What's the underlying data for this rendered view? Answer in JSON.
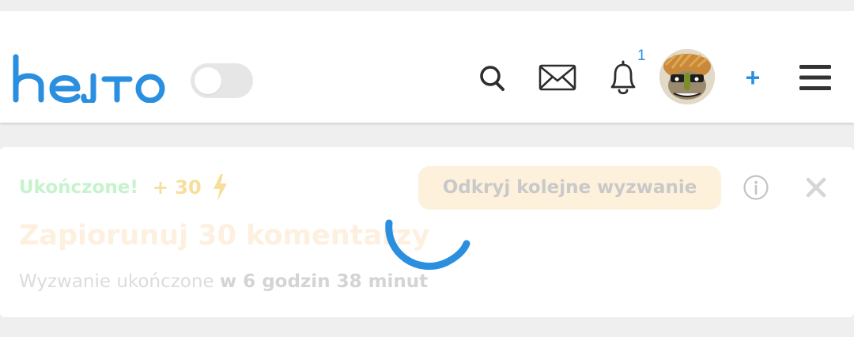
{
  "header": {
    "logo_text": "hejto",
    "notification_count": "1",
    "add_label": "+",
    "theme_toggle_on": false,
    "icons": [
      "search-icon",
      "mail-icon",
      "bell-icon",
      "avatar",
      "menu-icon"
    ]
  },
  "challenge": {
    "status_label": "Ukończone!",
    "points": "+ 30",
    "discover_button": "Odkryj kolejne wyzwanie",
    "title": "Zapiorunuj 30 komentarzy",
    "subtitle_prefix": "Wyzwanie ukończone",
    "subtitle_time": "w 6 godzin 38 minut"
  },
  "colors": {
    "accent": "#2b8fe0",
    "success_faded": "#c6f2cc",
    "points_faded": "#f8dd9d",
    "button_bg": "#fdf1dc"
  }
}
